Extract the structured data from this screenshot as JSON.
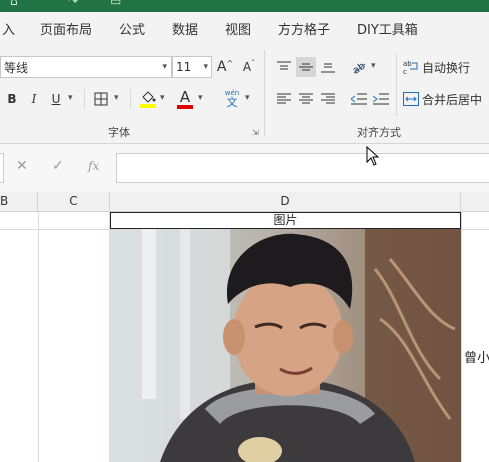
{
  "menu": {
    "items": [
      "入",
      "页面布局",
      "公式",
      "数据",
      "视图",
      "方方格子",
      "DIY工具箱"
    ]
  },
  "font_group": {
    "font_name": "等线",
    "font_size": "11",
    "increase_font": "A",
    "decrease_font": "A",
    "bold": "B",
    "italic": "I",
    "underline": "U",
    "font_color_letter": "A",
    "phonetic_top": "wén",
    "phonetic_bottom": "文",
    "label": "字体"
  },
  "align_group": {
    "wrap_text": "自动换行",
    "merge_center": "合并后居中",
    "label": "对齐方式"
  },
  "formula_bar": {
    "cancel": "✕",
    "confirm": "✓",
    "fx": "fx"
  },
  "columns": [
    "B",
    "C",
    "D"
  ],
  "cell_header": "图片",
  "side_text": "曾小",
  "colors": {
    "accent": "#217346",
    "fill_yellow": "#ffff00",
    "font_red": "#e00000"
  }
}
